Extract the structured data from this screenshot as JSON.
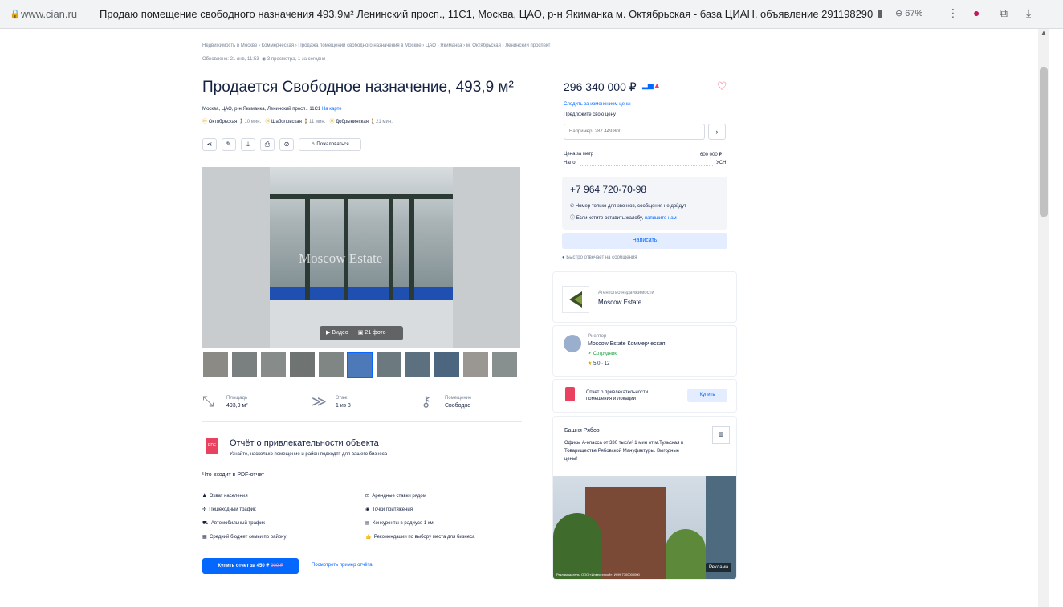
{
  "browser": {
    "domain": "www.cian.ru",
    "tab_title": "Продаю помещение свободного назначения 493.9м² Ленинский просп., 11С1, Москва, ЦАО, р-н Якиманка м. Октябрьская - база ЦИАН, объявление 291198290",
    "zoom": "67%"
  },
  "breadcrumbs": [
    "Недвижимость в Москве",
    "Коммерческая",
    "Продажа помещений свободного назначения в Москве",
    "ЦАО",
    "Якиманка",
    "м. Октябрьская",
    "Ленинский проспект"
  ],
  "updated": "Обновлено: 21 янв, 11:53",
  "views": "3 просмотра, 1 за сегодня",
  "listing": {
    "title": "Продается Свободное назначение, 493,9 м²",
    "address": "Москва, ЦАО, р-н Якиманка, Ленинский просп., 11С1",
    "map_link": "На карте",
    "metro": [
      {
        "name": "Октябрьская",
        "time": "10 мин."
      },
      {
        "name": "Шаболовская",
        "time": "11 мин."
      },
      {
        "name": "Добрынинская",
        "time": "21 мин."
      }
    ],
    "complain": "Пожаловаться"
  },
  "photo": {
    "watermark": "Moscow Estate",
    "video_label": "Видео",
    "photos_label": "21 фото"
  },
  "facts": [
    {
      "label": "Площадь",
      "value": "493,9 м²"
    },
    {
      "label": "Этаж",
      "value": "1 из 8"
    },
    {
      "label": "Помещение",
      "value": "Свободно"
    }
  ],
  "report": {
    "title": "Отчёт о привлекательности объекта",
    "subtitle": "Узнайте, насколько помещение и район подходят для вашего бизнеса",
    "includes_title": "Что входит в PDF-отчет",
    "items_left": [
      "Охват населения",
      "Пешеходный трафик",
      "Автомобильный трафик",
      "Средний бюджет семьи по району"
    ],
    "items_right": [
      "Арендные ставки рядом",
      "Точки притяжения",
      "Конкуренты в радиусе 1 км",
      "Рекомендации по выбору места для бизнеса"
    ],
    "buy_button": "Купить отчет за 450 ₽",
    "old_price": "900 ₽",
    "example_link": "Посмотреть пример отчёта"
  },
  "sidebar": {
    "price": "296 340 000 ₽",
    "follow_price": "Следить за изменением цены",
    "offer_label": "Предложите свою цену",
    "offer_placeholder": "Например, 287 449 800",
    "price_per_meter_label": "Цена за метр",
    "price_per_meter": "600 000 ₽",
    "tax_label": "Налог",
    "tax_value": "УСН",
    "phone": "+7 964 720-70-98",
    "phone_note": "Номер только для звонков, сообщения не дойдут",
    "complain_note": "Если хотите оставить жалобу,",
    "complain_link": "напишите нам",
    "write_button": "Написать",
    "fast_reply": "Быстро отвечает на сообщения",
    "agency_label": "Агентство недвижимости",
    "agency_name": "Moscow Estate",
    "agent_label": "Риелтор",
    "agent_name": "Moscow Estate Коммерческая",
    "agent_badge": "Сотрудник",
    "agent_rating": "5.0 · 12",
    "report_card_text": "Отчет о привлекательности помещения и локации",
    "report_card_button": "Купить",
    "ad_title": "Башня Рябов",
    "ad_text": "Офисы А-класса от 330 тыс/м² 1 мин от м.Тульская в Товариществе Рябовской Мануфактуры. Выгодные цены!",
    "ad_label": "Реклама",
    "ad_disclaimer": "Рекламодатель: ООО «Инвестстрой», ИНН 7700000000"
  },
  "colors": {
    "accent": "#0468ff",
    "text": "#152242",
    "muted": "#7a8596",
    "metro": "#e0a500",
    "pdf_red": "#e84260"
  }
}
